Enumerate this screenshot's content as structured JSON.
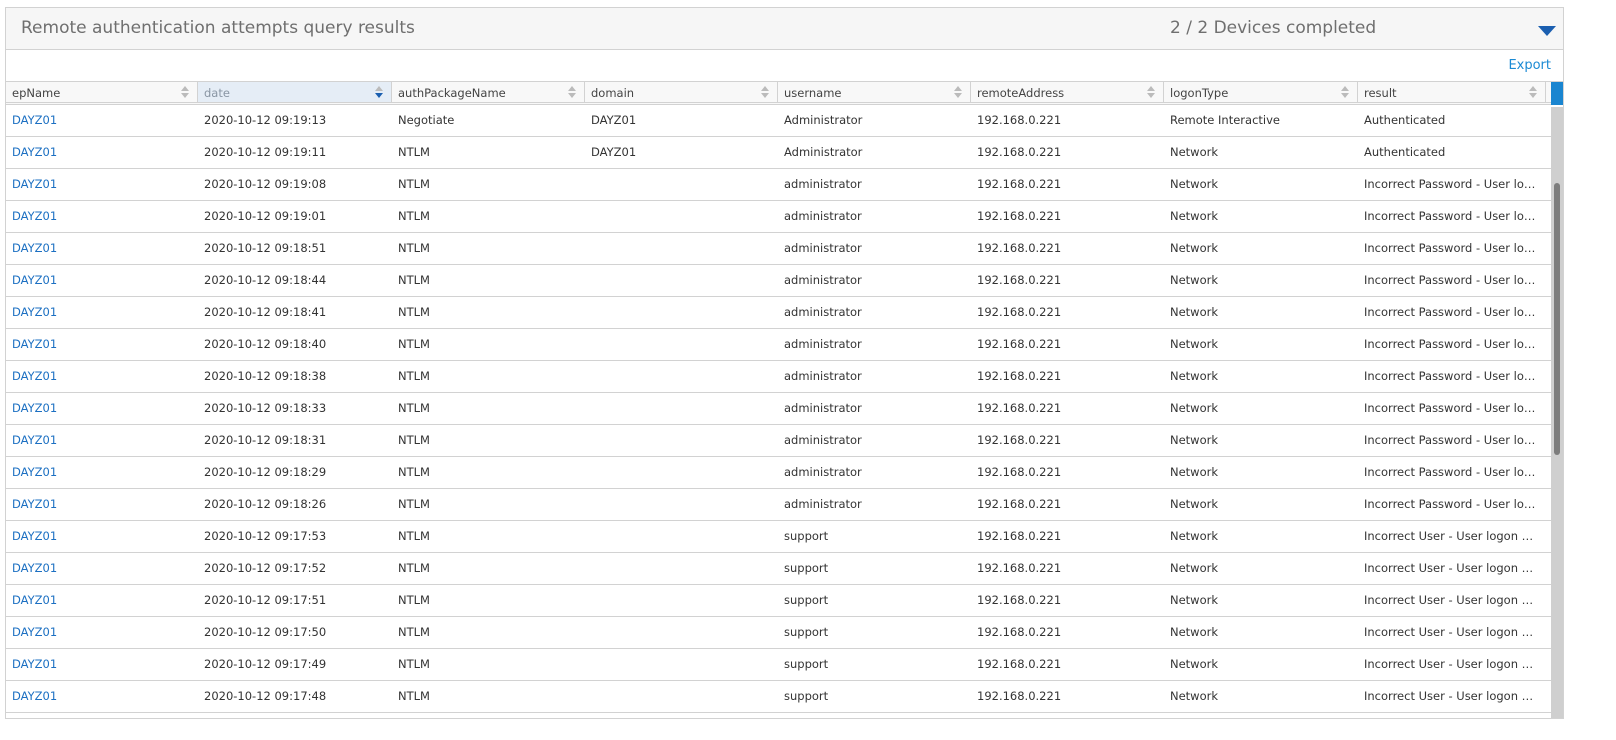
{
  "header": {
    "title": "Remote authentication attempts query results",
    "status": "2 / 2 Devices completed"
  },
  "toolbar": {
    "export_label": "Export"
  },
  "columns": [
    "epName",
    "date",
    "authPackageName",
    "domain",
    "username",
    "remoteAddress",
    "logonType",
    "result"
  ],
  "sorted_column": "date",
  "rows": [
    [
      "DAYZ01",
      "2020-10-12 09:19:13",
      "Negotiate",
      "DAYZ01",
      "Administrator",
      "192.168.0.221",
      "Remote Interactive",
      "Authenticated"
    ],
    [
      "DAYZ01",
      "2020-10-12 09:19:11",
      "NTLM",
      "DAYZ01",
      "Administrator",
      "192.168.0.221",
      "Network",
      "Authenticated"
    ],
    [
      "DAYZ01",
      "2020-10-12 09:19:08",
      "NTLM",
      "",
      "administrator",
      "192.168.0.221",
      "Network",
      "Incorrect Password - User logon ..."
    ],
    [
      "DAYZ01",
      "2020-10-12 09:19:01",
      "NTLM",
      "",
      "administrator",
      "192.168.0.221",
      "Network",
      "Incorrect Password - User logon ..."
    ],
    [
      "DAYZ01",
      "2020-10-12 09:18:51",
      "NTLM",
      "",
      "administrator",
      "192.168.0.221",
      "Network",
      "Incorrect Password - User logon ..."
    ],
    [
      "DAYZ01",
      "2020-10-12 09:18:44",
      "NTLM",
      "",
      "administrator",
      "192.168.0.221",
      "Network",
      "Incorrect Password - User logon ..."
    ],
    [
      "DAYZ01",
      "2020-10-12 09:18:41",
      "NTLM",
      "",
      "administrator",
      "192.168.0.221",
      "Network",
      "Incorrect Password - User logon ..."
    ],
    [
      "DAYZ01",
      "2020-10-12 09:18:40",
      "NTLM",
      "",
      "administrator",
      "192.168.0.221",
      "Network",
      "Incorrect Password - User logon ..."
    ],
    [
      "DAYZ01",
      "2020-10-12 09:18:38",
      "NTLM",
      "",
      "administrator",
      "192.168.0.221",
      "Network",
      "Incorrect Password - User logon ..."
    ],
    [
      "DAYZ01",
      "2020-10-12 09:18:33",
      "NTLM",
      "",
      "administrator",
      "192.168.0.221",
      "Network",
      "Incorrect Password - User logon ..."
    ],
    [
      "DAYZ01",
      "2020-10-12 09:18:31",
      "NTLM",
      "",
      "administrator",
      "192.168.0.221",
      "Network",
      "Incorrect Password - User logon ..."
    ],
    [
      "DAYZ01",
      "2020-10-12 09:18:29",
      "NTLM",
      "",
      "administrator",
      "192.168.0.221",
      "Network",
      "Incorrect Password - User logon ..."
    ],
    [
      "DAYZ01",
      "2020-10-12 09:18:26",
      "NTLM",
      "",
      "administrator",
      "192.168.0.221",
      "Network",
      "Incorrect Password - User logon ..."
    ],
    [
      "DAYZ01",
      "2020-10-12 09:17:53",
      "NTLM",
      "",
      "support",
      "192.168.0.221",
      "Network",
      "Incorrect User - User logon with ..."
    ],
    [
      "DAYZ01",
      "2020-10-12 09:17:52",
      "NTLM",
      "",
      "support",
      "192.168.0.221",
      "Network",
      "Incorrect User - User logon with ..."
    ],
    [
      "DAYZ01",
      "2020-10-12 09:17:51",
      "NTLM",
      "",
      "support",
      "192.168.0.221",
      "Network",
      "Incorrect User - User logon with ..."
    ],
    [
      "DAYZ01",
      "2020-10-12 09:17:50",
      "NTLM",
      "",
      "support",
      "192.168.0.221",
      "Network",
      "Incorrect User - User logon with ..."
    ],
    [
      "DAYZ01",
      "2020-10-12 09:17:49",
      "NTLM",
      "",
      "support",
      "192.168.0.221",
      "Network",
      "Incorrect User - User logon with ..."
    ],
    [
      "DAYZ01",
      "2020-10-12 09:17:48",
      "NTLM",
      "",
      "support",
      "192.168.0.221",
      "Network",
      "Incorrect User - User logon with ..."
    ]
  ],
  "colors": {
    "accent": "#1a85d0",
    "link": "#1b6fc2"
  }
}
